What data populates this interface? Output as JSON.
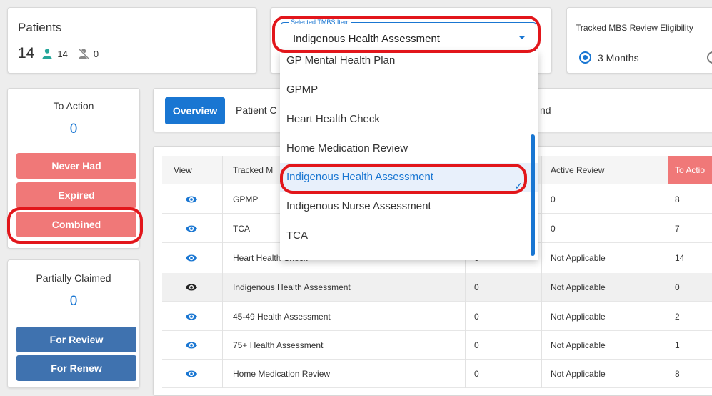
{
  "patients": {
    "title": "Patients",
    "total": "14",
    "active_count": "14",
    "inactive_count": "0"
  },
  "tmbs_select": {
    "legend": "Selected TMBS Item",
    "value": "Indigenous Health Assessment"
  },
  "tracked": {
    "title": "Tracked MBS Review Eligibility",
    "option_selected": "3 Months"
  },
  "to_action": {
    "title": "To Action",
    "count": "0",
    "buttons": [
      "Never Had",
      "Expired",
      "Combined"
    ]
  },
  "partially_claimed": {
    "title": "Partially Claimed",
    "count": "0",
    "buttons": [
      "For Review",
      "For Renew"
    ]
  },
  "tabs": {
    "active": "Overview",
    "second": "Patient C",
    "third": "nd"
  },
  "table": {
    "headers": [
      "View",
      "Tracked M",
      "Active Review",
      "To Actio"
    ],
    "rows": [
      {
        "item": "GPMP",
        "claimed": "",
        "active": "0",
        "to_action": "8"
      },
      {
        "item": "TCA",
        "claimed": "",
        "active": "0",
        "to_action": "7"
      },
      {
        "item": "Heart Health Check",
        "claimed": "0",
        "active": "Not Applicable",
        "to_action": "14"
      },
      {
        "item": "Indigenous Health Assessment",
        "claimed": "0",
        "active": "Not Applicable",
        "to_action": "0"
      },
      {
        "item": "45-49 Health Assessment",
        "claimed": "0",
        "active": "Not Applicable",
        "to_action": "2"
      },
      {
        "item": "75+ Health Assessment",
        "claimed": "0",
        "active": "Not Applicable",
        "to_action": "1"
      },
      {
        "item": "Home Medication Review",
        "claimed": "0",
        "active": "Not Applicable",
        "to_action": "8"
      }
    ]
  },
  "dropdown": {
    "options": [
      "GP Mental Health Plan",
      "GPMP",
      "Heart Health Check",
      "Home Medication Review",
      "Indigenous Health Assessment",
      "Indigenous Nurse Assessment",
      "TCA"
    ],
    "selected_index": 4,
    "check_glyph": "✓"
  },
  "colors": {
    "primary": "#1976d2",
    "danger_button": "#f07878",
    "secondary_button": "#3f72af",
    "annotation": "#e2161b",
    "active_patients_icon": "#26a69a"
  }
}
